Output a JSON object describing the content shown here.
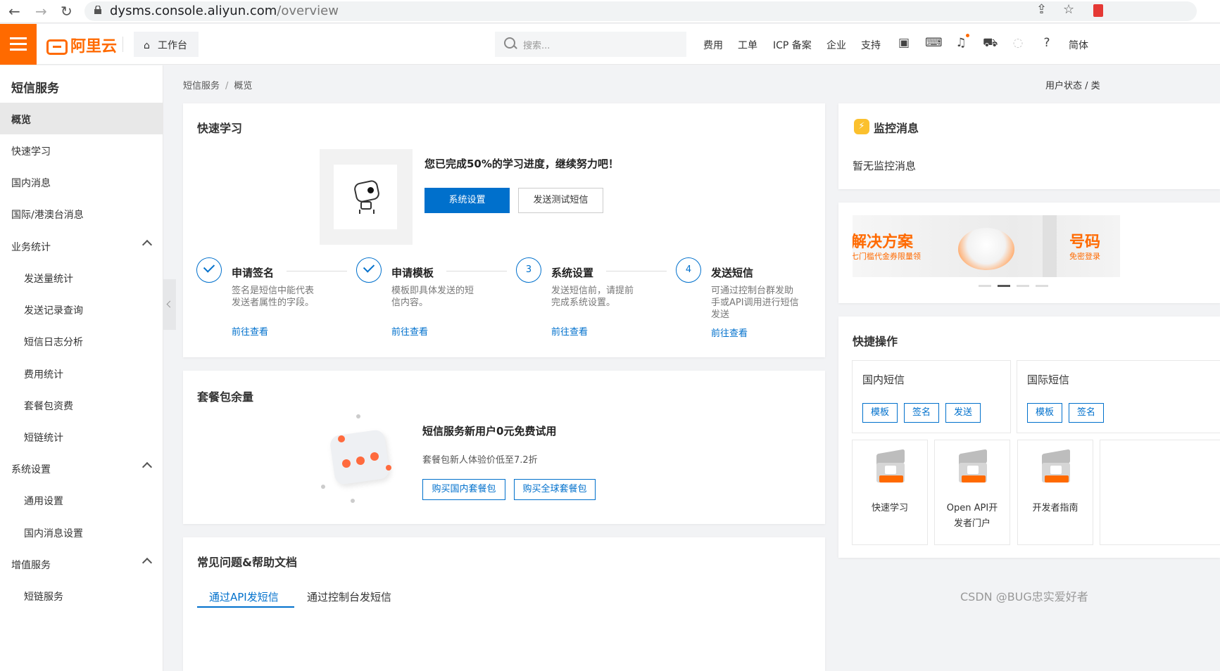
{
  "browser": {
    "url_host": "dysms.console.aliyun.com",
    "url_path": "/overview"
  },
  "topnav": {
    "logo": "阿里云",
    "workbench": "工作台",
    "search_placeholder": "搜索...",
    "items": [
      "费用",
      "工单",
      "ICP 备案",
      "企业",
      "支持"
    ],
    "lang": "简体"
  },
  "sidebar": {
    "title": "短信服务",
    "items": [
      {
        "label": "概览",
        "active": true,
        "sub": false
      },
      {
        "label": "快速学习",
        "sub": false
      },
      {
        "label": "国内消息",
        "sub": false
      },
      {
        "label": "国际/港澳台消息",
        "sub": false
      },
      {
        "label": "业务统计",
        "sub": false,
        "expanded": true
      },
      {
        "label": "发送量统计",
        "sub": true
      },
      {
        "label": "发送记录查询",
        "sub": true
      },
      {
        "label": "短信日志分析",
        "sub": true
      },
      {
        "label": "费用统计",
        "sub": true
      },
      {
        "label": "套餐包资费",
        "sub": true
      },
      {
        "label": "短链统计",
        "sub": true
      },
      {
        "label": "系统设置",
        "sub": false,
        "expanded": true
      },
      {
        "label": "通用设置",
        "sub": true
      },
      {
        "label": "国内消息设置",
        "sub": true
      },
      {
        "label": "增值服务",
        "sub": false,
        "expanded": true
      },
      {
        "label": "短链服务",
        "sub": true
      }
    ]
  },
  "breadcrumb": {
    "root": "短信服务",
    "current": "概览"
  },
  "user_state": "用户状态 / 类",
  "quick_learn": {
    "title": "快速学习",
    "progress_text": "您已完成50%的学习进度，继续努力吧！",
    "btn_primary": "系统设置",
    "btn_secondary": "发送测试短信",
    "steps": [
      {
        "num": "",
        "done": true,
        "title": "申请签名",
        "desc": [
          "签名是短信中能代表",
          "发送者属性的字段。"
        ],
        "link": "前往查看"
      },
      {
        "num": "",
        "done": true,
        "title": "申请模板",
        "desc": [
          "模板即具体发送的短",
          "信内容。"
        ],
        "link": "前往查看"
      },
      {
        "num": "3",
        "done": false,
        "title": "系统设置",
        "desc": [
          "发送短信前，请提前",
          "完成系统设置。"
        ],
        "link": "前往查看"
      },
      {
        "num": "4",
        "done": false,
        "title": "发送短信",
        "desc": [
          "可通过控制台群发助",
          "手或API调用进行短信",
          "发送"
        ],
        "link": "前往查看"
      }
    ]
  },
  "package": {
    "title": "套餐包余量",
    "headline": "短信服务新用户0元免费试用",
    "sub": "套餐包新人体验价低至7.2折",
    "btn_domestic": "购买国内套餐包",
    "btn_global": "购买全球套餐包"
  },
  "faq": {
    "title": "常见问题&帮助文档",
    "tabs": [
      "通过API发短信",
      "通过控制台发短信"
    ]
  },
  "monitor": {
    "title": "监控消息",
    "empty": "暂无监控消息"
  },
  "banner": {
    "slide1_title": "解决方案",
    "slide1_sub": "七门槛代金券限量领",
    "slide2_title": "号码",
    "slide2_sub": "免密登录"
  },
  "shortcuts": {
    "title": "快捷操作",
    "domestic": {
      "title": "国内短信",
      "buttons": [
        "模板",
        "签名",
        "发送"
      ]
    },
    "international": {
      "title": "国际短信",
      "buttons": [
        "模板",
        "签名"
      ]
    },
    "tiles": [
      {
        "label1": "快速学习",
        "label2": ""
      },
      {
        "label1": "Open API开",
        "label2": "发者门户"
      },
      {
        "label1": "开发者指南",
        "label2": ""
      }
    ]
  },
  "watermark": "CSDN @BUG忠实爱好者",
  "colors": {
    "brand": "#ff6a00",
    "primary": "#0070cc"
  }
}
